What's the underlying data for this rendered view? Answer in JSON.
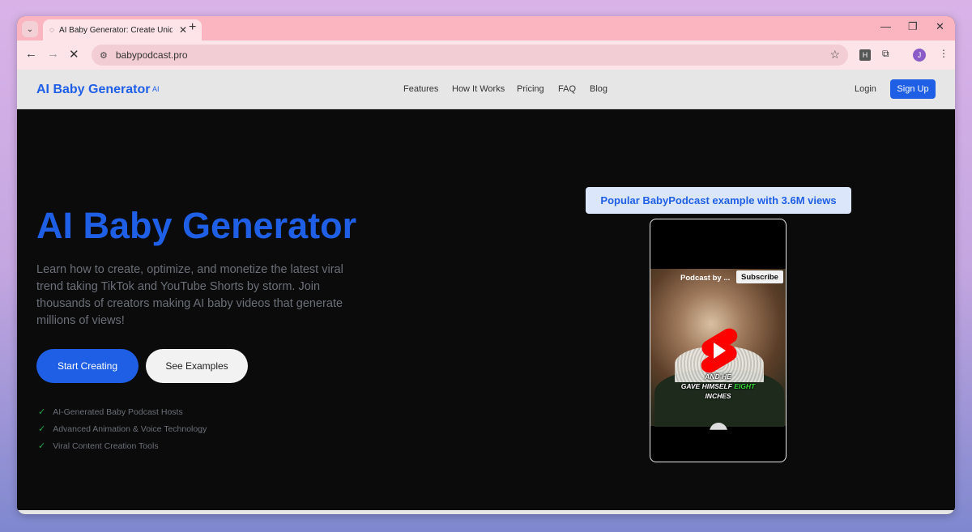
{
  "browser": {
    "tab_title": "AI Baby Generator: Create Uniq",
    "url": "babypodcast.pro",
    "profile_initial": "J",
    "ext_label": "H"
  },
  "site": {
    "logo": "AI Baby Generator",
    "logo_badge": "AI",
    "nav": [
      "Features",
      "How It Works",
      "Pricing",
      "FAQ",
      "Blog"
    ],
    "login": "Login",
    "signup": "Sign Up"
  },
  "hero": {
    "title": "AI Baby Generator",
    "description": "Learn how to create, optimize, and monetize the latest viral trend taking TikTok and YouTube Shorts by storm. Join thousands of creators making AI baby videos that generate millions of views!",
    "primary_button": "Start Creating",
    "secondary_button": "See Examples",
    "features": [
      "AI-Generated Baby Podcast Hosts",
      "Advanced Animation & Voice Technology",
      "Viral Content Creation Tools"
    ],
    "popular_label": "Popular BabyPodcast example with 3.6M views"
  },
  "video": {
    "channel_title": "Podcast by ...",
    "subscribe": "Subscribe",
    "caption_line1": "AND HE",
    "caption_line2_a": "GAVE HIMSELF",
    "caption_line2_b": "EIGHT",
    "caption_line3": "INCHES"
  },
  "colors": {
    "brand_blue": "#1f5fe6",
    "tab_pink": "#fbb5c0",
    "check_green": "#1fa34a"
  }
}
